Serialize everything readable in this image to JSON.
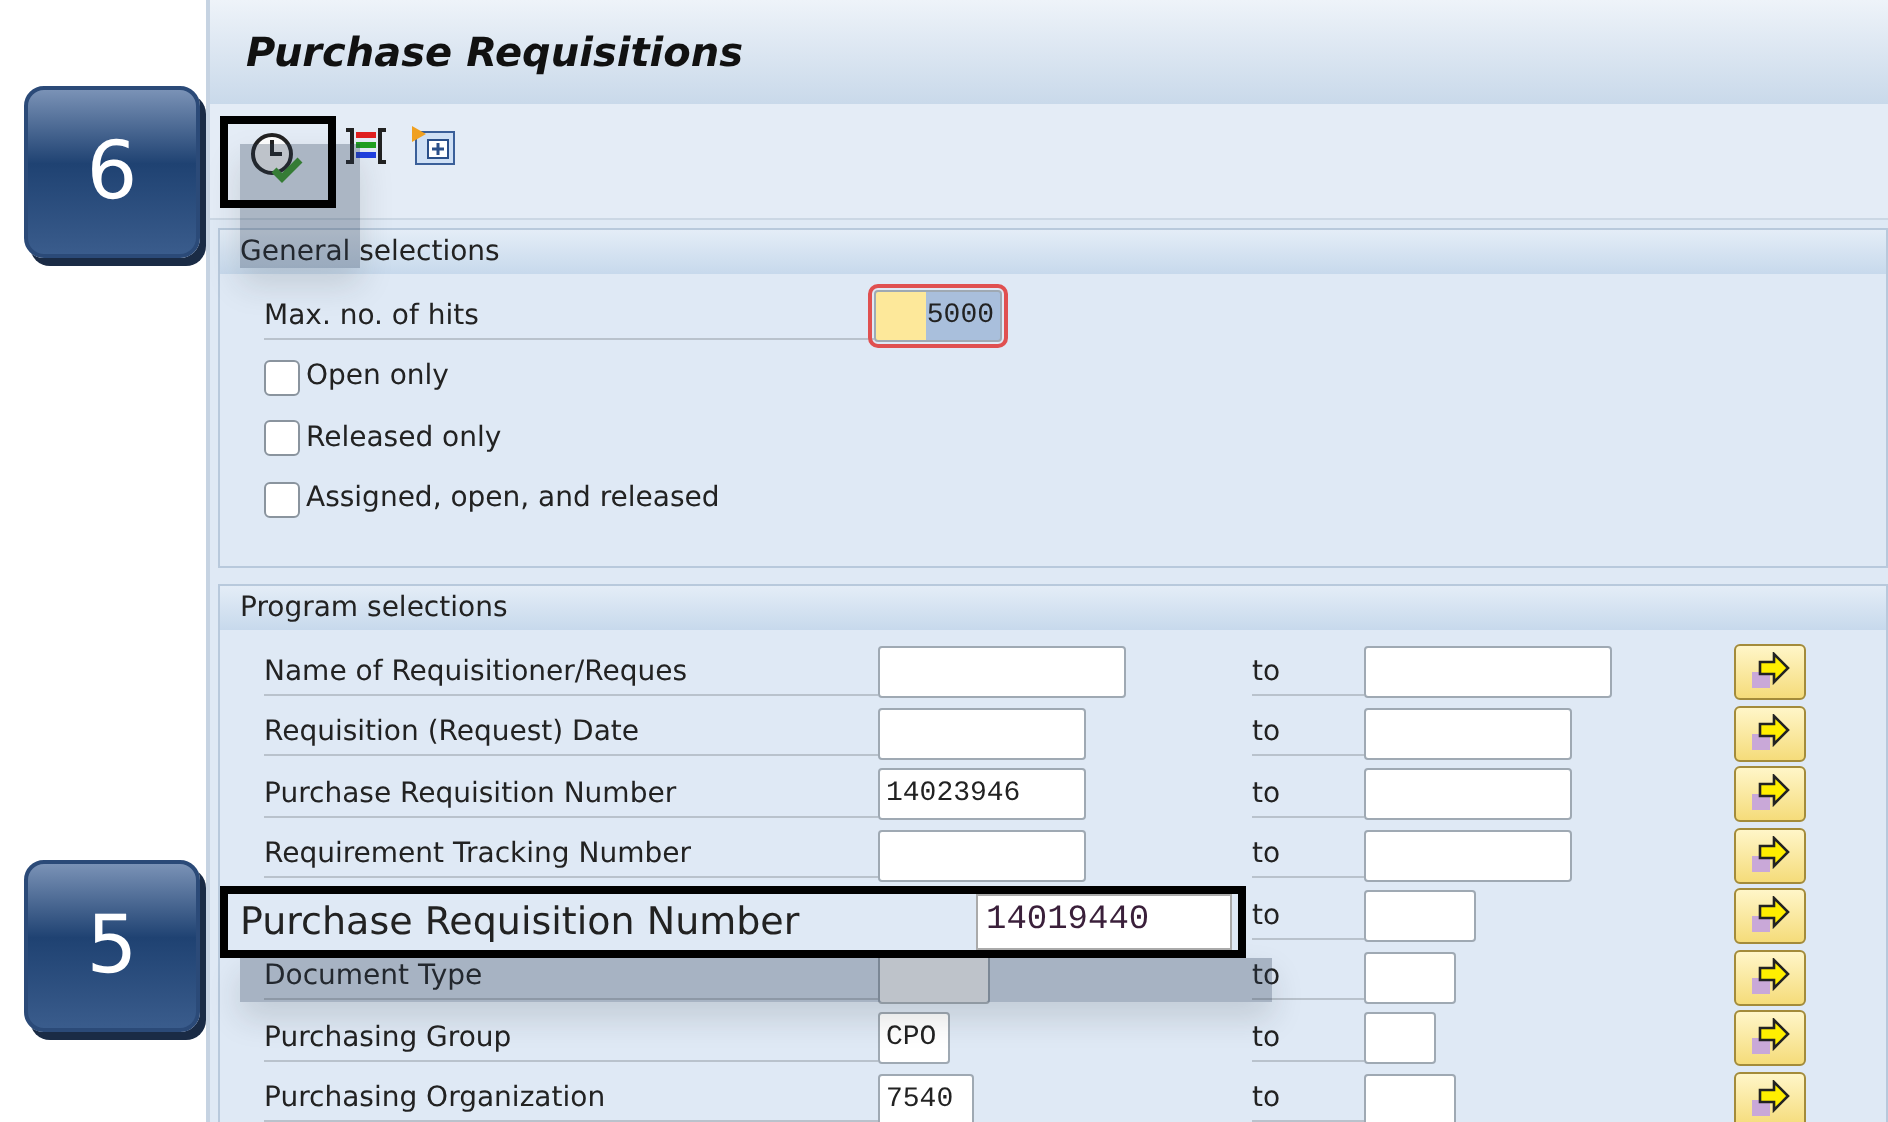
{
  "title": "Purchase Requisitions",
  "general_selections": {
    "title": "General selections",
    "max_hits": {
      "label": "Max. no. of hits",
      "value": "5000",
      "focused": true
    },
    "checkboxes": [
      {
        "label": "Open only",
        "checked": false
      },
      {
        "label": "Released only",
        "checked": false
      },
      {
        "label": "Assigned, open, and released",
        "checked": false
      }
    ]
  },
  "program_selections": {
    "title": "Program selections",
    "rows": [
      {
        "label": "Name of Requisitioner/Reques",
        "from": "",
        "to_label": "to"
      },
      {
        "label": "Requisition (Request) Date",
        "from": "",
        "to_label": "to"
      },
      {
        "label": "Purchase Requisition Number",
        "from": "14023946",
        "to_label": "to"
      },
      {
        "label": "Requirement Tracking Number",
        "from": "",
        "to_label": "to"
      },
      {
        "to_label": "to"
      },
      {
        "label": "Document Type",
        "from": "",
        "to_label": "to"
      },
      {
        "label": "Purchasing Group",
        "from": "CPO",
        "to_label": "to"
      },
      {
        "label": "Purchasing Organization",
        "from": "7540",
        "to_label": "to"
      }
    ]
  },
  "steps": [
    {
      "number": "6"
    },
    {
      "number": "5"
    }
  ],
  "callout": {
    "label": "Purchase Requisition Number",
    "value": "14019440"
  }
}
